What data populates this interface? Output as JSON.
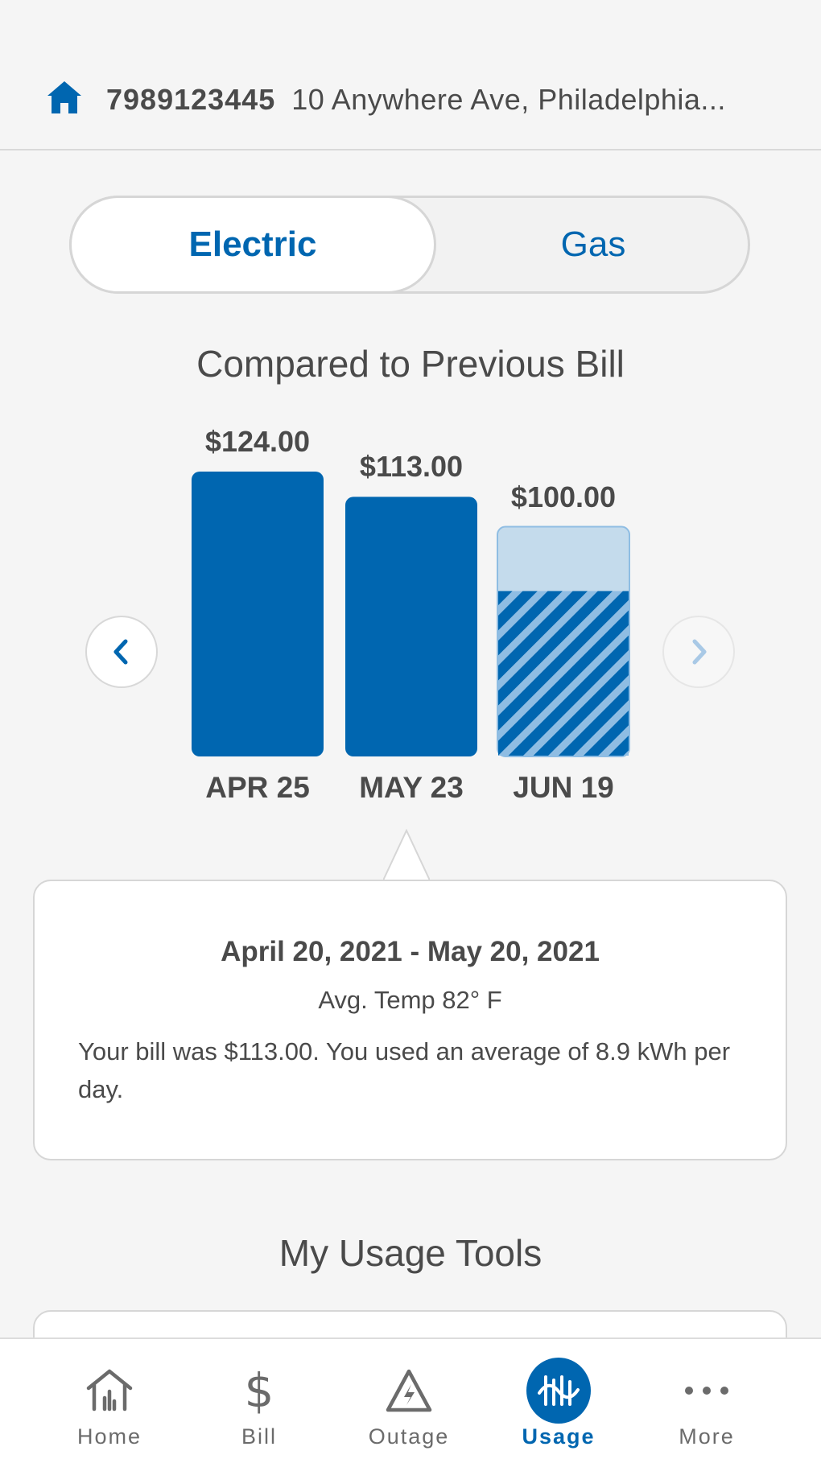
{
  "account": {
    "number": "7989123445",
    "address": "10 Anywhere Ave, Philadelphia..."
  },
  "segment": {
    "options": [
      "Electric",
      "Gas"
    ],
    "selected": "Electric"
  },
  "comparison_title": "Compared to Previous Bill",
  "chart_data": {
    "type": "bar",
    "categories": [
      "APR 25",
      "MAY 23",
      "JUN 19"
    ],
    "values": [
      124.0,
      113.0,
      100.0
    ],
    "value_labels": [
      "$124.00",
      "$113.00",
      "$100.00"
    ],
    "projected_bar": "JUN 19",
    "selected_bar": "MAY 23",
    "colors": {
      "bar": "#0066b0",
      "projected_bg": "#c4dbec",
      "projected_stripe": "#8fbde3"
    }
  },
  "detail": {
    "dates": "April 20, 2021 - May 20, 2021",
    "temp": "Avg. Temp 82° F",
    "description": "Your bill was $113.00. You used an average of 8.9 kWh per day."
  },
  "tools_title": "My Usage Tools",
  "tabs": [
    {
      "label": "Home",
      "icon": "home-bars-icon"
    },
    {
      "label": "Bill",
      "icon": "dollar-icon"
    },
    {
      "label": "Outage",
      "icon": "warning-bolt-icon"
    },
    {
      "label": "Usage",
      "icon": "usage-wave-icon"
    },
    {
      "label": "More",
      "icon": "ellipsis-icon"
    }
  ],
  "active_tab": "Usage",
  "colors": {
    "accent": "#0066b0",
    "background": "#f5f5f5"
  }
}
